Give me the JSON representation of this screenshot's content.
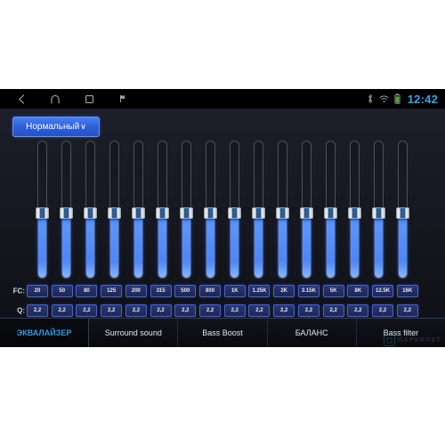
{
  "statusbar": {
    "nav": [
      {
        "name": "back-icon",
        "label": "Back"
      },
      {
        "name": "home-icon",
        "label": "Home"
      },
      {
        "name": "recents-icon",
        "label": "Recent apps"
      },
      {
        "name": "flag-icon",
        "label": "Flag"
      }
    ],
    "icons": [
      "bluetooth-icon",
      "wifi-icon",
      "battery-icon"
    ],
    "time": "12:42",
    "time_color": "#35a5e8"
  },
  "preset": {
    "label": "Нормальный",
    "chevron": "∨"
  },
  "equalizer": {
    "band_count": 16,
    "slider_value_percent": 47,
    "fc_row_label": "FC:",
    "q_row_label": "Q:",
    "frequencies": [
      "20",
      "50",
      "80",
      "125",
      "200",
      "315",
      "500",
      "800",
      "1K",
      "1.25K",
      "2K",
      "3.15K",
      "5K",
      "8K",
      "12.5K",
      "16K"
    ],
    "q_values": [
      "2,2",
      "2,2",
      "2,2",
      "2,2",
      "2,2",
      "2,2",
      "2,2",
      "2,2",
      "2,2",
      "2,2",
      "2,2",
      "2,2",
      "2,2",
      "2,2",
      "2,2",
      "2,2"
    ],
    "accent_color": "#4d86f8"
  },
  "tabs": [
    {
      "label": "ЭКВАЛАЙЗЕР",
      "active": true
    },
    {
      "label": "Surround sound",
      "active": false
    },
    {
      "label": "Bass Boost",
      "active": false
    },
    {
      "label": "БАЛАНС",
      "active": false
    },
    {
      "label": "Bass filter",
      "active": false
    }
  ],
  "watermark": {
    "text": "ПАРКФЛЕТ"
  }
}
